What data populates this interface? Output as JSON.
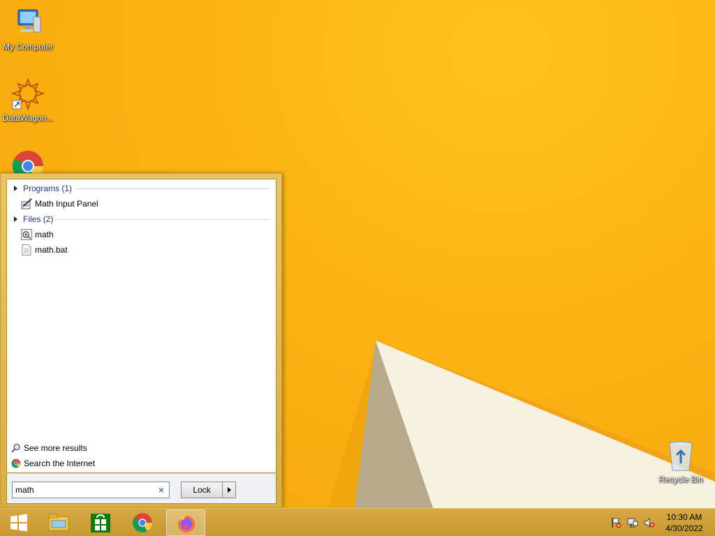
{
  "desktop": {
    "icons": [
      {
        "label": "My Computer",
        "icon": "my-computer-icon"
      },
      {
        "label": "DataWagon...",
        "icon": "datawagon-icon"
      },
      {
        "label": "",
        "icon": "chrome-icon"
      },
      {
        "label": "Recycle Bin",
        "icon": "recycle-bin-icon"
      }
    ]
  },
  "start_menu": {
    "groups": [
      {
        "label": "Programs (1)",
        "items": [
          {
            "label": "Math Input Panel",
            "icon": "math-input-panel-icon"
          }
        ]
      },
      {
        "label": "Files (2)",
        "items": [
          {
            "label": "math",
            "icon": "settings-file-icon"
          },
          {
            "label": "math.bat",
            "icon": "text-file-icon"
          }
        ]
      }
    ],
    "see_more": "See more results",
    "search_internet": "Search the Internet",
    "search": {
      "value": "math",
      "clear": "×"
    },
    "power_button": "Lock"
  },
  "taskbar": {
    "pinned": [
      "start-button-icon",
      "file-explorer-icon",
      "store-icon",
      "chrome-icon",
      "firefox-icon"
    ],
    "active_index": 4,
    "clock": {
      "time": "10:30 AM",
      "date": "4/30/2022"
    }
  },
  "colors": {
    "wallpaper": "#f9b10f",
    "taskbar": "#c7982f",
    "link": "#1e3287"
  }
}
